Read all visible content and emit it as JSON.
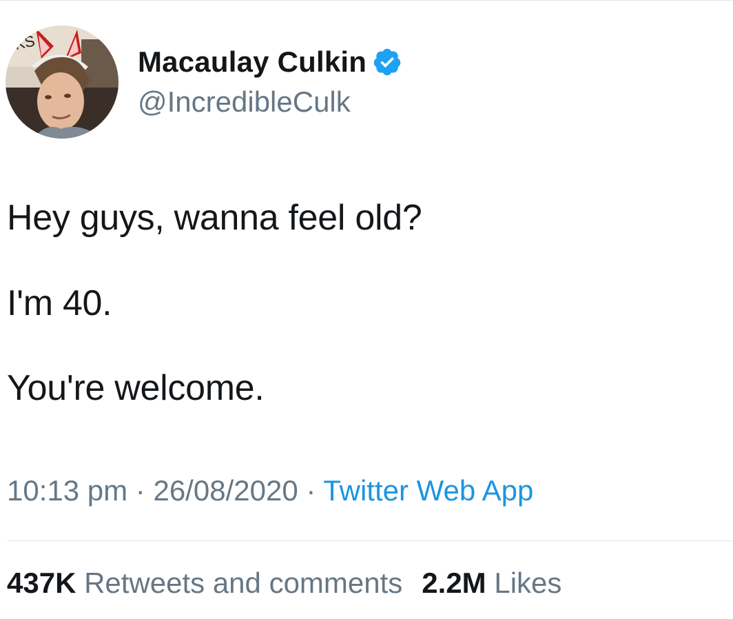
{
  "author": {
    "display_name": "Macaulay Culkin",
    "handle": "@IncredibleCulk",
    "verified": true,
    "avatar_sign_text": "KS"
  },
  "tweet": {
    "lines": [
      "Hey guys, wanna feel old?",
      "I'm 40.",
      "You're welcome."
    ]
  },
  "meta": {
    "time": "10:13 pm",
    "separator": "·",
    "date": "26/08/2020",
    "source": "Twitter Web App"
  },
  "stats": {
    "retweets_count": "437K",
    "retweets_label": "Retweets and comments",
    "likes_count": "2.2M",
    "likes_label": "Likes"
  },
  "colors": {
    "text": "#14171a",
    "secondary": "#657786",
    "link": "#1b95e0",
    "verified": "#1da1f2",
    "divider": "#e1e8ed"
  }
}
